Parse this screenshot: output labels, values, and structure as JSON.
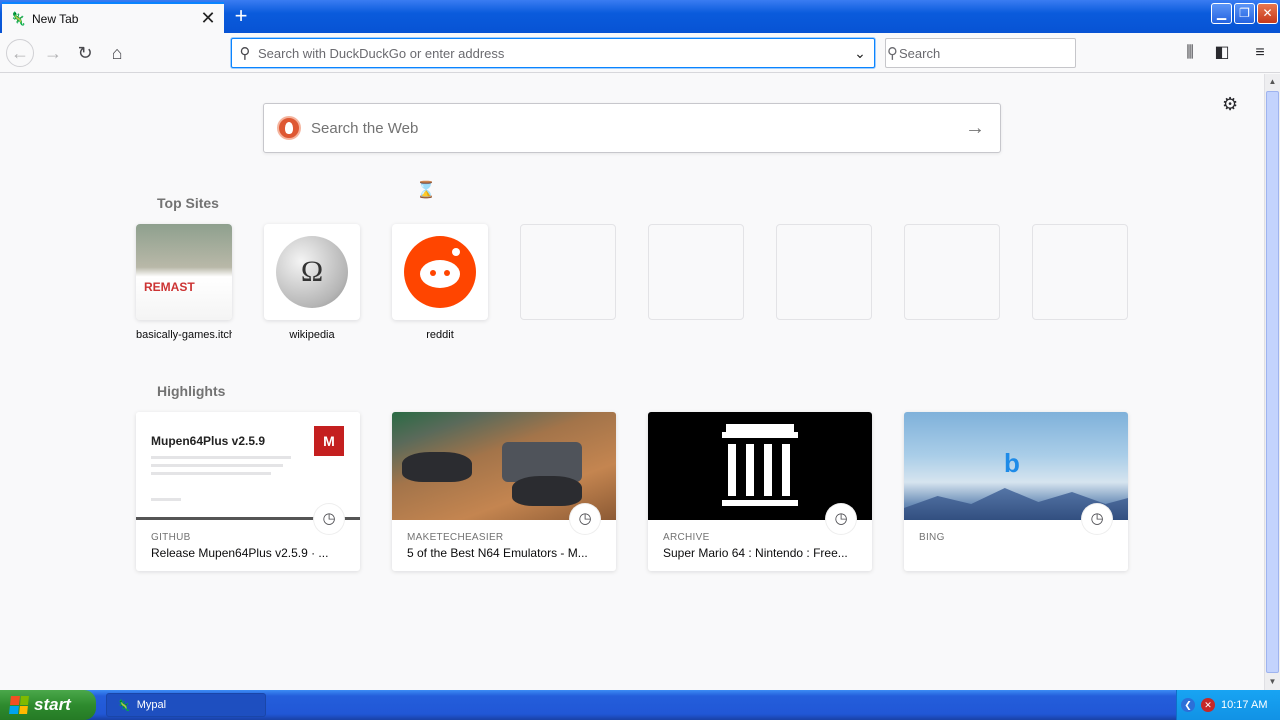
{
  "window": {
    "tab_title": "New Tab",
    "tab_close": "✕",
    "new_tab": "+",
    "minimize": "▁",
    "restore": "❐",
    "close": "✕"
  },
  "toolbar": {
    "url_placeholder": "Search with DuckDuckGo or enter address",
    "search_placeholder": "Search"
  },
  "page": {
    "web_search_placeholder": "Search the Web",
    "top_sites_title": "Top Sites",
    "highlights_title": "Highlights",
    "top_sites": [
      {
        "label": "basically-games.itch",
        "empty": false
      },
      {
        "label": "wikipedia",
        "empty": false
      },
      {
        "label": "reddit",
        "empty": false
      },
      {
        "label": "",
        "empty": true
      },
      {
        "label": "",
        "empty": true
      },
      {
        "label": "",
        "empty": true
      },
      {
        "label": "",
        "empty": true
      },
      {
        "label": "",
        "empty": true
      }
    ],
    "highlights": [
      {
        "source": "GITHUB",
        "title": "Release Mupen64Plus v2.5.9 · ...",
        "thumb_heading": "Mupen64Plus v2.5.9"
      },
      {
        "source": "MAKETECHEASIER",
        "title": "5 of the Best N64 Emulators - M...",
        "thumb_heading": ""
      },
      {
        "source": "ARCHIVE",
        "title": "Super Mario 64 : Nintendo : Free...",
        "thumb_heading": ""
      },
      {
        "source": "BING",
        "title": "",
        "thumb_heading": ""
      }
    ]
  },
  "taskbar": {
    "start_label": "start",
    "task_label": "Mypal",
    "clock": "10:17 AM"
  },
  "colors": {
    "accent": "#0a84ff",
    "reddit": "#ff4500",
    "taskbar": "#245edb",
    "start_green": "#2e8b2e"
  }
}
